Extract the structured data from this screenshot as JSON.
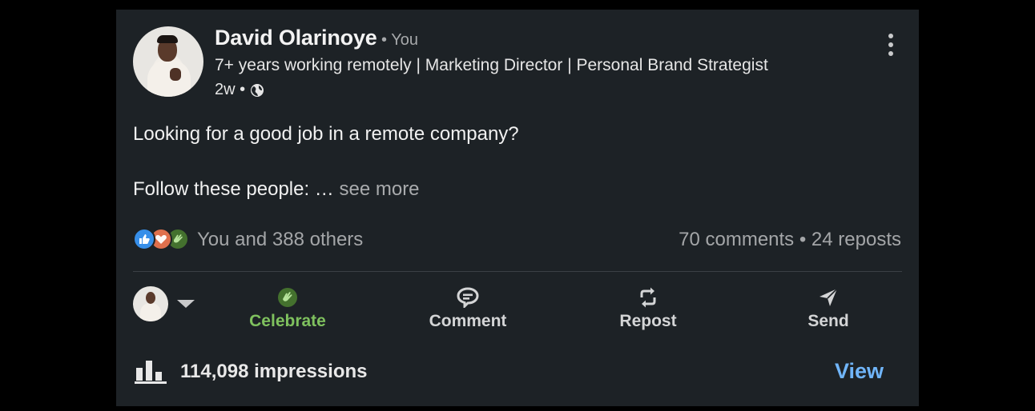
{
  "post": {
    "author": {
      "name": "David Olarinoye",
      "you_tag": "• You",
      "headline": "7+ years working remotely | Marketing Director | Personal Brand Strategist",
      "time": "2w •",
      "visibility_icon": "globe-icon"
    },
    "text_line1": "Looking for a good job in a remote company?",
    "text_line2": "Follow these people: … ",
    "see_more": "see more",
    "reactions": {
      "icons": [
        "like-icon",
        "love-icon",
        "celebrate-icon"
      ],
      "summary": "You and 388 others"
    },
    "counts": "70 comments • 24 reposts"
  },
  "actions": {
    "celebrate": "Celebrate",
    "comment": "Comment",
    "repost": "Repost",
    "send": "Send"
  },
  "impressions": {
    "text": "114,098 impressions",
    "view": "View"
  },
  "colors": {
    "card_bg": "#1d2226",
    "link_blue": "#70b5f9",
    "celebrate_green": "#7fc15e",
    "like_blue": "#378fe9",
    "love_red": "#df704d"
  }
}
